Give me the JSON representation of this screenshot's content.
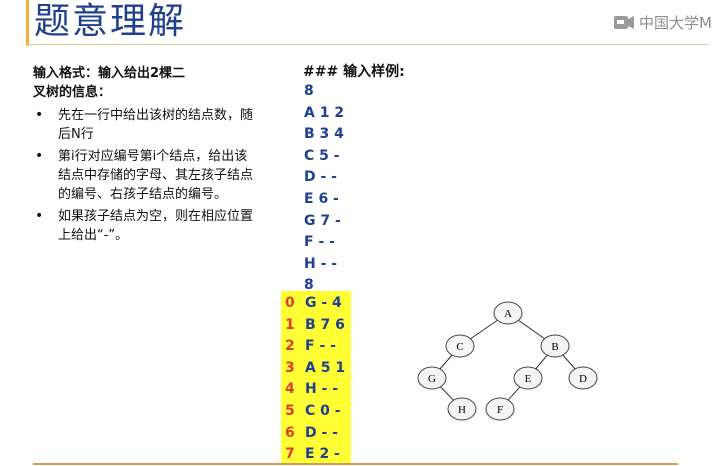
{
  "header": {
    "title": "题意理解",
    "watermark": "中国大学M"
  },
  "left": {
    "intro_line1": "输入格式：输入给出2棵二",
    "intro_line2": "叉树的信息：",
    "bullets": [
      "先在一行中给出该树的结点数，随后N行",
      "第i行对应编号第i个结点，给出该结点中存储的字母、其左孩子结点的编号、右孩子结点的编号。",
      "如果孩子结点为空，则在相应位置上给出“-”。"
    ]
  },
  "sample": {
    "heading": "### 输入样例:",
    "lines": [
      "8",
      "A 1 2",
      "B 3 4",
      "C 5 -",
      "D - -",
      "E 6 -",
      "G 7 -",
      "F - -",
      "H - -",
      "8"
    ],
    "highlighted": [
      {
        "idx": "0",
        "val": "G - 4"
      },
      {
        "idx": "1",
        "val": "B 7 6"
      },
      {
        "idx": "2",
        "val": "F - -"
      },
      {
        "idx": "3",
        "val": "A 5 1"
      },
      {
        "idx": "4",
        "val": "H - -"
      },
      {
        "idx": "5",
        "val": "C 0 -"
      },
      {
        "idx": "6",
        "val": "D - -"
      },
      {
        "idx": "7",
        "val": "E 2 -"
      }
    ]
  },
  "tree": {
    "nodes": [
      "A",
      "C",
      "B",
      "G",
      "E",
      "D",
      "H",
      "F"
    ]
  },
  "colors": {
    "title": "#1f3f8f",
    "highlight": "#ffff33",
    "index": "#e23b2a",
    "rule": "#d39b58"
  }
}
